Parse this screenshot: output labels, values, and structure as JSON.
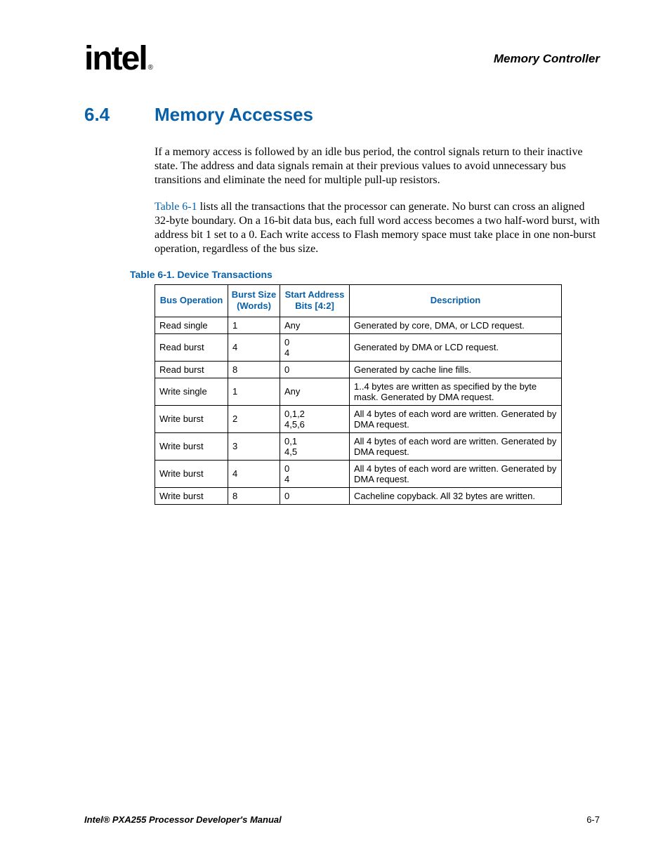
{
  "header": {
    "logo_text": "intel",
    "reg": "®",
    "chapter": "Memory Controller"
  },
  "section": {
    "number": "6.4",
    "title": "Memory Accesses"
  },
  "paragraphs": {
    "p1": "If a memory access is followed by an idle bus period, the control signals return to their inactive state. The address and data signals remain at their previous values to avoid unnecessary bus transitions and eliminate the need for multiple pull-up resistors.",
    "p2_link": "Table 6-1",
    "p2_rest": " lists all the transactions that the processor can generate. No burst can cross an aligned 32-byte boundary. On a 16-bit data bus, each full word access becomes a two half-word burst, with address bit 1 set to a 0. Each write access to Flash memory space must take place in one non-burst operation, regardless of the bus size."
  },
  "table": {
    "caption": "Table 6-1. Device Transactions",
    "headers": {
      "op": "Bus Operation",
      "burst": "Burst Size (Words)",
      "addr": "Start Address Bits [4:2]",
      "desc": "Description"
    },
    "rows": [
      {
        "op": "Read single",
        "burst": "1",
        "addr": "Any",
        "desc": "Generated by core, DMA, or LCD request."
      },
      {
        "op": "Read burst",
        "burst": "4",
        "addr": "0\n4",
        "desc": "Generated by DMA or LCD request."
      },
      {
        "op": "Read burst",
        "burst": "8",
        "addr": "0",
        "desc": "Generated by cache line fills."
      },
      {
        "op": "Write single",
        "burst": "1",
        "addr": "Any",
        "desc": "1..4 bytes are written as specified by the byte mask. Generated by DMA request."
      },
      {
        "op": "Write burst",
        "burst": "2",
        "addr": "0,1,2\n4,5,6",
        "desc": "All 4 bytes of each word are written. Generated by DMA request."
      },
      {
        "op": "Write burst",
        "burst": "3",
        "addr": "0,1\n4,5",
        "desc": "All 4 bytes of each word are written. Generated by DMA request."
      },
      {
        "op": "Write burst",
        "burst": "4",
        "addr": "0\n4",
        "desc": "All 4 bytes of each word are written. Generated by DMA request."
      },
      {
        "op": "Write burst",
        "burst": "8",
        "addr": "0",
        "desc": "Cacheline copyback. All 32 bytes are written."
      }
    ]
  },
  "footer": {
    "left": "Intel® PXA255 Processor Developer's Manual",
    "right": "6-7"
  }
}
